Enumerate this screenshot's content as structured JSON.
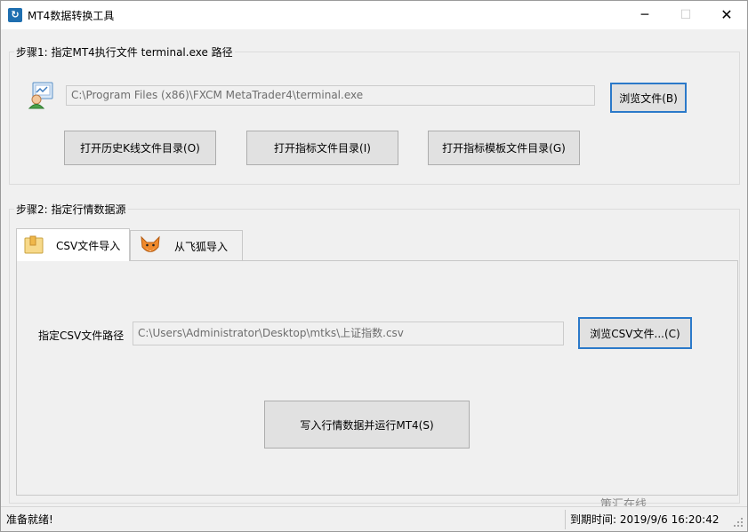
{
  "window": {
    "title": "MT4数据转换工具",
    "icon": "app-logo-icon",
    "controls": {
      "minimize": "─",
      "maximize": "☐",
      "close": "✕"
    }
  },
  "step1": {
    "title": "步骤1:  指定MT4执行文件 terminal.exe 路径",
    "icon": "terminal-user-icon",
    "path_value": "C:\\Program Files (x86)\\FXCM MetaTrader4\\terminal.exe",
    "browse_label": "浏览文件(B)",
    "open_history_label": "打开历史K线文件目录(O)",
    "open_indicator_label": "打开指标文件目录(I)",
    "open_template_label": "打开指标模板文件目录(G)"
  },
  "step2": {
    "title": "步骤2:  指定行情数据源",
    "tabs": [
      {
        "label": "CSV文件导入",
        "icon": "folder-icon"
      },
      {
        "label": "从飞狐导入",
        "icon": "fox-icon"
      }
    ],
    "csv_path_label": "指定CSV文件路径",
    "csv_path_value": "C:\\Users\\Administrator\\Desktop\\mtks\\上证指数.csv",
    "browse_csv_label": "浏览CSV文件...(C)",
    "write_run_label": "写入行情数据并运行MT4(S)"
  },
  "watermark": "策汇在线",
  "status": {
    "left": "准备就绪!",
    "right": "到期时间: 2019/9/6 16:20:42"
  },
  "colors": {
    "focus_border": "#2b79c9",
    "window_bg": "#f0f0f0",
    "app_icon": "#1f6fb0"
  }
}
